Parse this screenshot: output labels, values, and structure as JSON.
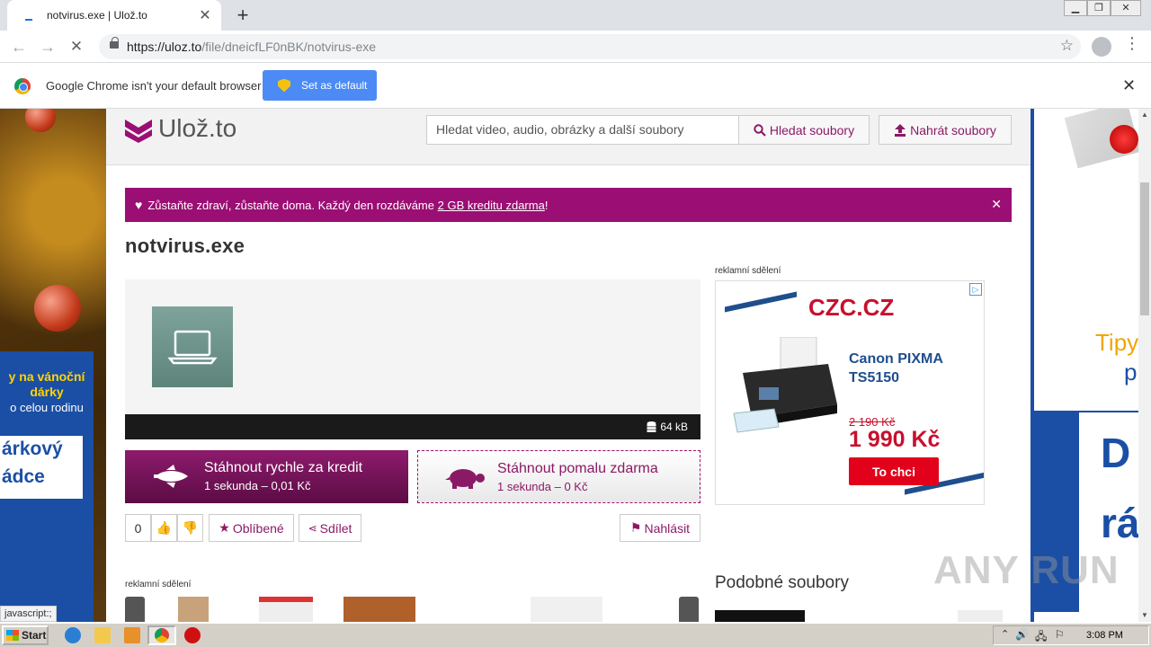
{
  "browser": {
    "tab_title": "notvirus.exe | Ulož.to",
    "url_host": "https://uloz.to",
    "url_path": "/file/dneicfLF0nBK/notvirus-exe",
    "infobar_text": "Google Chrome isn't your default browser",
    "set_default_label": "Set as default"
  },
  "site": {
    "logo_text": "Ulož.to",
    "search_placeholder": "Hledat video, audio, obrázky a další soubory",
    "search_button": "Hledat soubory",
    "upload_button": "Nahrát soubory",
    "banner_text_before": "Zůstaňte zdraví, zůstaňte doma. Každý den rozdáváme ",
    "banner_link": "2 GB kreditu zdarma",
    "banner_text_after": "!",
    "file_name": "notvirus.exe",
    "file_size": "64 kB",
    "fast_download_title": "Stáhnout rychle za kredit",
    "fast_download_sub": "1 sekunda – 0,01 Kč",
    "slow_download_title": "Stáhnout pomalu zdarma",
    "slow_download_sub": "1 sekunda – 0 Kč",
    "vote_count": "0",
    "favorite_label": "Oblíbené",
    "share_label": "Sdílet",
    "report_label": "Nahlásit",
    "ad_label": "reklamní sdělení",
    "similar_heading": "Podobné soubory"
  },
  "ad": {
    "brand": "CZC.CZ",
    "product_line1": "Canon PIXMA",
    "product_line2": "TS5150",
    "old_price": "2 190 Kč",
    "price": "1 990 Kč",
    "cta": "To chci"
  },
  "side_ads": {
    "left_line1": "y na vánoční",
    "left_line2": "dárky",
    "left_line3": "o celou rodinu",
    "left_brand1": "árkový",
    "left_brand2": "ádce",
    "right_text1": "Tipy",
    "right_text2": "p",
    "right_big1": "D",
    "right_big2": "rá"
  },
  "status_url": "javascript:;",
  "watermark": "ANY RUN",
  "taskbar": {
    "start_label": "Start",
    "clock": "3:08 PM"
  },
  "colors": {
    "brand": "#9b0e73",
    "ad_red": "#c8102e",
    "ad_blue": "#1f4e8c"
  }
}
